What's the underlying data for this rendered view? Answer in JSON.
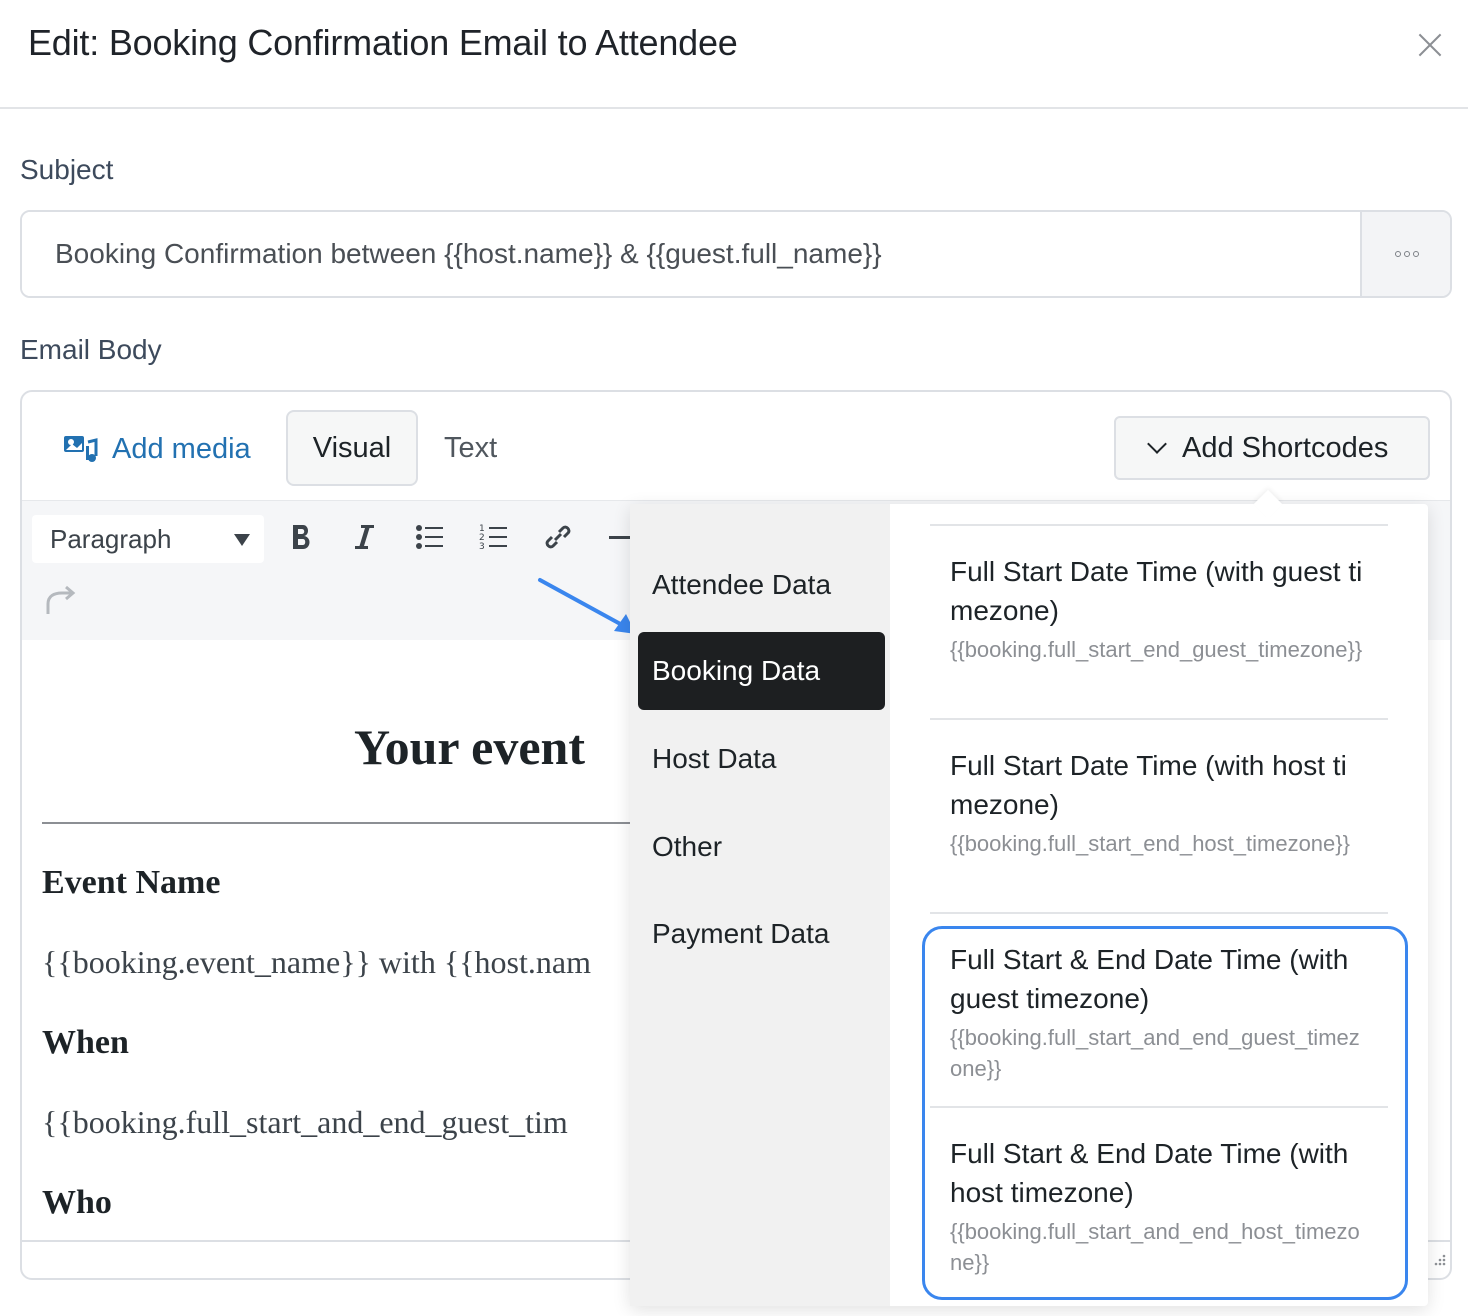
{
  "dialog": {
    "title": "Edit: Booking Confirmation Email to Attendee"
  },
  "subject": {
    "label": "Subject",
    "value": "Booking Confirmation between {{host.name}} & {{guest.full_name}}"
  },
  "body": {
    "label": "Email Body",
    "add_media": "Add media",
    "tab_visual": "Visual",
    "tab_text": "Text",
    "add_shortcodes": "Add Shortcodes",
    "format": "Paragraph"
  },
  "content": {
    "title": "Your event",
    "h_event": "Event Name",
    "p_event": "{{booking.event_name}} with {{host.nam",
    "h_when": "When",
    "p_when": "{{booking.full_start_and_end_guest_tim",
    "h_who": "Who"
  },
  "shortcodes": {
    "categories": [
      {
        "label": "Attendee Data"
      },
      {
        "label": "Booking Data"
      },
      {
        "label": "Host Data"
      },
      {
        "label": "Other"
      },
      {
        "label": "Payment Data"
      }
    ],
    "items": [
      {
        "name": "Full Start Date Time (with guest timezone)",
        "code": "{{booking.full_start_end_guest_timezone}}"
      },
      {
        "name": "Full Start Date Time (with host timezone)",
        "code": "{{booking.full_start_end_host_timezone}}"
      },
      {
        "name": "Full Start & End Date Time (with guest timezone)",
        "code": "{{booking.full_start_and_end_guest_timezone}}"
      },
      {
        "name": "Full Start & End Date Time (with host timezone)",
        "code": "{{booking.full_start_and_end_host_timezone}}"
      }
    ]
  },
  "colors": {
    "accent": "#2271b1",
    "highlight": "#3a86ee",
    "active_category": "#1d1f21"
  }
}
